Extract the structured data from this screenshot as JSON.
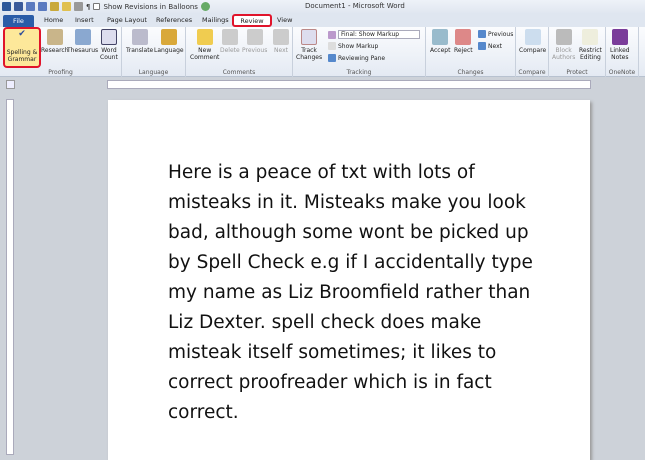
{
  "titlebar": {
    "title": "Document1 - Microsoft Word",
    "qa_checkbox_label": "Show Revisions in Balloons"
  },
  "tabs": [
    "File",
    "Home",
    "Insert",
    "Page Layout",
    "References",
    "Mailings",
    "Review",
    "View"
  ],
  "ribbon": {
    "proofing": {
      "label": "Proofing",
      "spelling": "Spelling &",
      "spelling2": "Grammar",
      "research": "Research",
      "thesaurus": "Thesaurus",
      "wordcount": "Word",
      "wordcount2": "Count"
    },
    "language": {
      "label": "Language",
      "translate": "Translate",
      "language": "Language"
    },
    "comments": {
      "label": "Comments",
      "new": "New",
      "new2": "Comment",
      "delete": "Delete",
      "previous": "Previous",
      "next": "Next"
    },
    "tracking": {
      "label": "Tracking",
      "track": "Track",
      "track2": "Changes",
      "display": "Final: Show Markup",
      "show_markup": "Show Markup",
      "reviewing_pane": "Reviewing Pane"
    },
    "changes": {
      "label": "Changes",
      "accept": "Accept",
      "reject": "Reject",
      "previous": "Previous",
      "next": "Next"
    },
    "compare": {
      "label": "Compare",
      "compare": "Compare"
    },
    "protect": {
      "label": "Protect",
      "block": "Block",
      "block2": "Authors",
      "restrict": "Restrict",
      "restrict2": "Editing"
    },
    "onenote": {
      "label": "OneNote",
      "linked": "Linked",
      "linked2": "Notes"
    }
  },
  "document": {
    "text": "Here is a peace of txt with lots of misteaks in it. Misteaks make you look bad, although some wont be picked up by Spell Check e.g if I accidentally type my name as Liz Broomfield rather than Liz Dexter. spell check does make misteak itself sometimes; it likes to correct proofreader which is in fact correct."
  },
  "colors": {
    "highlight": "#e0142b",
    "file_tab": "#2a5ca8",
    "spell_button": "#fde89a"
  }
}
